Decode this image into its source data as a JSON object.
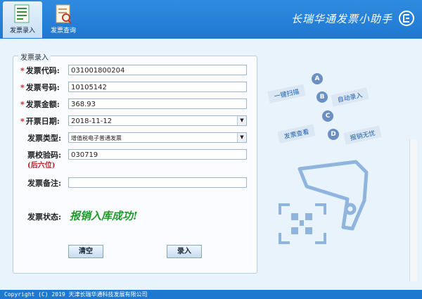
{
  "app": {
    "title": "长瑞华通发票小助手"
  },
  "toolbar": {
    "entry_label": "发票录入",
    "query_label": "发票查询"
  },
  "form": {
    "legend": "发票录入",
    "code_label": "发票代码:",
    "code_value": "031001800204",
    "number_label": "发票号码:",
    "number_value": "10105142",
    "amount_label": "发票金额:",
    "amount_value": "368.93",
    "date_label": "开票日期:",
    "date_value": "2018-11-12",
    "type_label": "发票类型:",
    "type_value": "增值税电子普通发票",
    "check_label": "票校验码:",
    "check_note": "(后六位)",
    "check_value": "030719",
    "remark_label": "发票备注:",
    "remark_value": "",
    "status_label": "发票状态:",
    "status_value": "报销入库成功!"
  },
  "buttons": {
    "clear": "清空",
    "submit": "录入"
  },
  "features": [
    {
      "letter": "A",
      "text": "一键扫描"
    },
    {
      "letter": "B",
      "text": "自动录入"
    },
    {
      "letter": "C",
      "text": "发票查看"
    },
    {
      "letter": "D",
      "text": "报销无忧"
    }
  ],
  "footer": {
    "text": "Copyright (C) 2019 天津长瑞华通科技发展有限公司"
  },
  "colors": {
    "accent": "#1f78d0",
    "success": "#1f9a2a",
    "required": "#d11111"
  }
}
